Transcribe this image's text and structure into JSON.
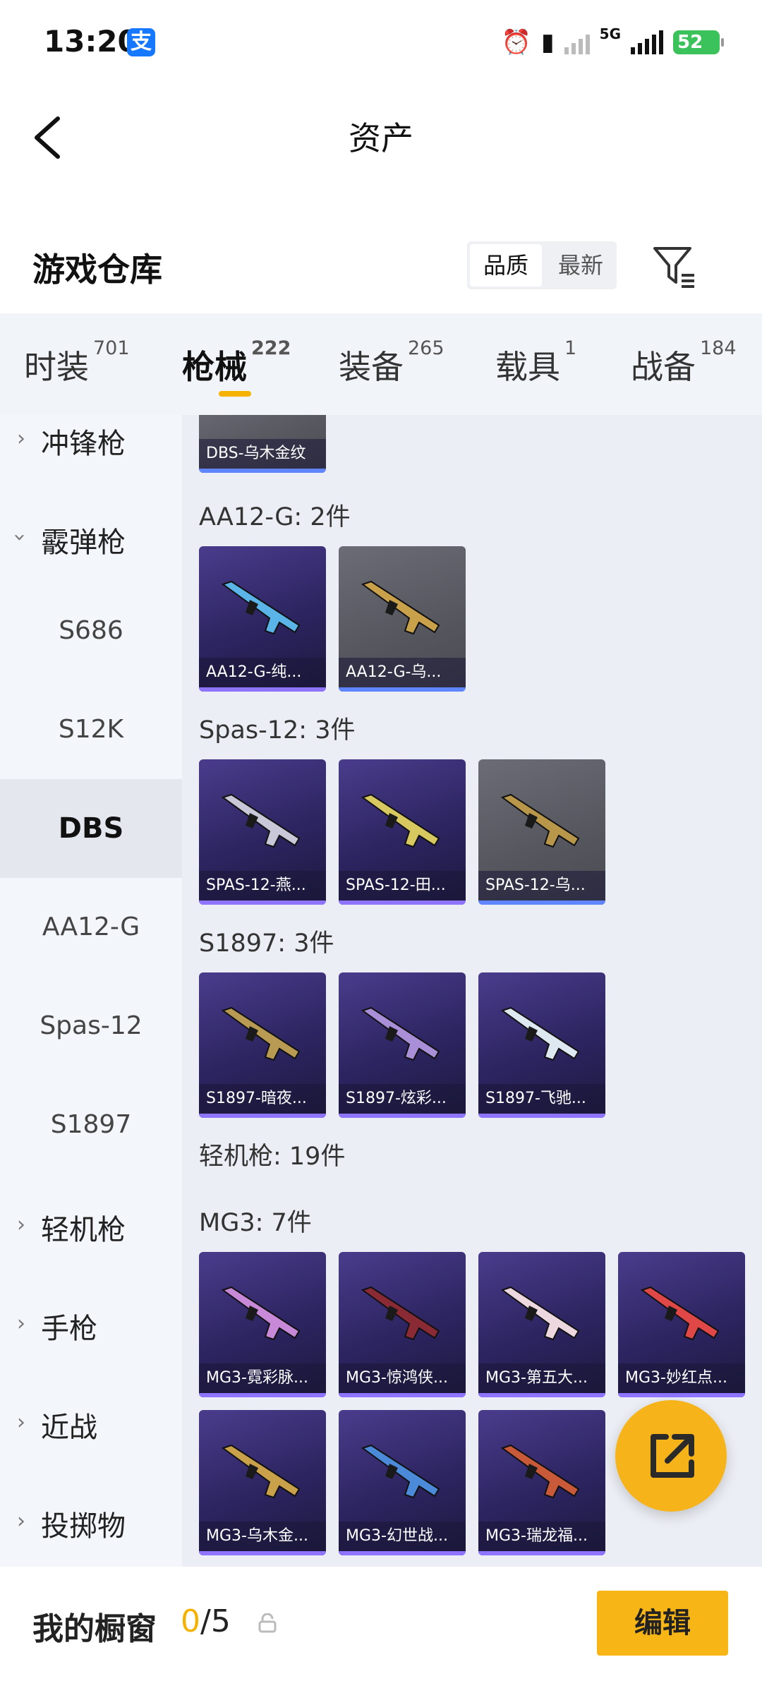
{
  "status_bar": {
    "time": "13:20",
    "alipay_icon_text": "支",
    "network_label": "5G",
    "battery": "52",
    "icons": [
      "alarm-icon",
      "vibrate-icon",
      "wifi-off-icon",
      "signal-icon",
      "battery-icon"
    ]
  },
  "header": {
    "title": "资产",
    "back_icon": "chevron-left-icon"
  },
  "warehouse": {
    "title": "游戏仓库",
    "sort_options": [
      "品质",
      "最新"
    ],
    "active_sort": "品质",
    "filter_icon": "filter-icon"
  },
  "tabs": [
    {
      "label": "时装",
      "count": "701"
    },
    {
      "label": "枪械",
      "count": "222"
    },
    {
      "label": "装备",
      "count": "265"
    },
    {
      "label": "载具",
      "count": "1"
    },
    {
      "label": "战备",
      "count": "184"
    }
  ],
  "active_tab": "枪械",
  "sidebar": {
    "items": [
      {
        "label": "冲锋枪",
        "type": "category",
        "expanded": false
      },
      {
        "label": "霰弹枪",
        "type": "category",
        "expanded": true
      },
      {
        "label": "S686",
        "type": "sub"
      },
      {
        "label": "S12K",
        "type": "sub"
      },
      {
        "label": "DBS",
        "type": "sub",
        "selected": true
      },
      {
        "label": "AA12-G",
        "type": "sub"
      },
      {
        "label": "Spas-12",
        "type": "sub"
      },
      {
        "label": "S1897",
        "type": "sub"
      },
      {
        "label": "轻机枪",
        "type": "category",
        "expanded": false
      },
      {
        "label": "手枪",
        "type": "category",
        "expanded": false
      },
      {
        "label": "近战",
        "type": "category",
        "expanded": false
      },
      {
        "label": "投掷物",
        "type": "category",
        "expanded": false
      }
    ]
  },
  "content": {
    "partial_item": {
      "label": "DBS-乌木金纹",
      "style": "gray"
    },
    "groups": [
      {
        "title": "AA12-G: 2件",
        "items": [
          {
            "label": "AA12-G-纯...",
            "style": "purple",
            "color": "#5ab4e8"
          },
          {
            "label": "AA12-G-乌...",
            "style": "gray",
            "color": "#c9a14a"
          }
        ]
      },
      {
        "title": "Spas-12: 3件",
        "items": [
          {
            "label": "SPAS-12-燕...",
            "style": "purple",
            "color": "#c8c8d8"
          },
          {
            "label": "SPAS-12-田...",
            "style": "purple",
            "color": "#d8c860"
          },
          {
            "label": "SPAS-12-乌...",
            "style": "gray",
            "color": "#b8964a"
          }
        ]
      },
      {
        "title": "S1897: 3件",
        "items": [
          {
            "label": "S1897-暗夜...",
            "style": "purple",
            "color": "#b89a52"
          },
          {
            "label": "S1897-炫彩...",
            "style": "purple",
            "color": "#a98fd8"
          },
          {
            "label": "S1897-飞驰...",
            "style": "purple",
            "color": "#dde8f0"
          }
        ]
      },
      {
        "title": "轻机枪: 19件",
        "items": []
      },
      {
        "title": "MG3: 7件",
        "items": [
          {
            "label": "MG3-霓彩脉...",
            "style": "purple",
            "color": "#c88ad8"
          },
          {
            "label": "MG3-惊鸿侠...",
            "style": "purple",
            "color": "#8a2a34"
          },
          {
            "label": "MG3-第五大...",
            "style": "purple",
            "color": "#eed8e0"
          },
          {
            "label": "MG3-妙红点...",
            "style": "purple",
            "color": "#e04848"
          },
          {
            "label": "MG3-乌木金...",
            "style": "purple",
            "color": "#c9a14a"
          },
          {
            "label": "MG3-幻世战...",
            "style": "purple",
            "color": "#4a8ad8"
          },
          {
            "label": "MG3-瑞龙福...",
            "style": "purple",
            "color": "#c85a3a"
          }
        ]
      }
    ]
  },
  "fab_icon": "share-external-icon",
  "bottom_bar": {
    "label": "我的橱窗",
    "used": "0",
    "total": "/5",
    "lock_icon": "lock-icon",
    "edit_label": "编辑"
  },
  "colors": {
    "accent": "#f5b200",
    "button": "#f8b516",
    "card_purple": "#2c2460",
    "card_gray": "#55565e"
  }
}
